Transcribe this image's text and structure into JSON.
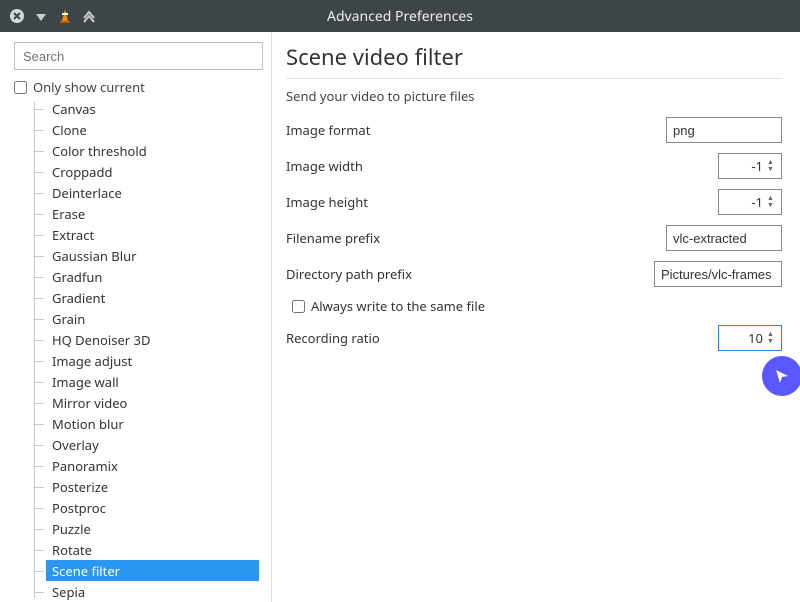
{
  "window": {
    "title": "Advanced Preferences"
  },
  "sidebar": {
    "search_placeholder": "Search",
    "only_show_current_label": "Only show current",
    "only_show_current_checked": false,
    "items": [
      {
        "label": "Canvas",
        "selected": false
      },
      {
        "label": "Clone",
        "selected": false
      },
      {
        "label": "Color threshold",
        "selected": false
      },
      {
        "label": "Croppadd",
        "selected": false
      },
      {
        "label": "Deinterlace",
        "selected": false
      },
      {
        "label": "Erase",
        "selected": false
      },
      {
        "label": "Extract",
        "selected": false
      },
      {
        "label": "Gaussian Blur",
        "selected": false
      },
      {
        "label": "Gradfun",
        "selected": false
      },
      {
        "label": "Gradient",
        "selected": false
      },
      {
        "label": "Grain",
        "selected": false
      },
      {
        "label": "HQ Denoiser 3D",
        "selected": false
      },
      {
        "label": "Image adjust",
        "selected": false
      },
      {
        "label": "Image wall",
        "selected": false
      },
      {
        "label": "Mirror video",
        "selected": false
      },
      {
        "label": "Motion blur",
        "selected": false
      },
      {
        "label": "Overlay",
        "selected": false
      },
      {
        "label": "Panoramix",
        "selected": false
      },
      {
        "label": "Posterize",
        "selected": false
      },
      {
        "label": "Postproc",
        "selected": false
      },
      {
        "label": "Puzzle",
        "selected": false
      },
      {
        "label": "Rotate",
        "selected": false
      },
      {
        "label": "Scene filter",
        "selected": true
      },
      {
        "label": "Sepia",
        "selected": false
      }
    ]
  },
  "panel": {
    "title": "Scene video filter",
    "subtitle": "Send your video to picture files",
    "fields": {
      "image_format": {
        "label": "Image format",
        "value": "png"
      },
      "image_width": {
        "label": "Image width",
        "value": "-1"
      },
      "image_height": {
        "label": "Image height",
        "value": "-1"
      },
      "filename_prefix": {
        "label": "Filename prefix",
        "value": "vlc-extracted"
      },
      "directory_prefix": {
        "label": "Directory path prefix",
        "value": "Pictures/vlc-frames"
      },
      "always_same_file": {
        "label": "Always write to the same file",
        "checked": false
      },
      "recording_ratio": {
        "label": "Recording ratio",
        "value": "10"
      }
    }
  }
}
